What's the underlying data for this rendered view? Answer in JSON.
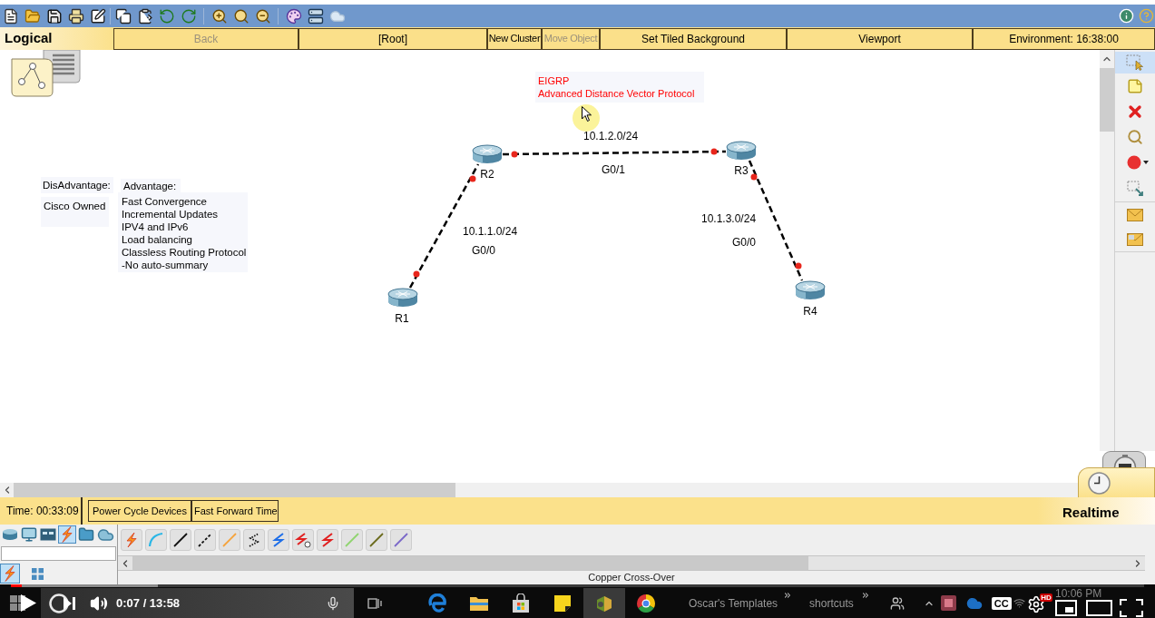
{
  "nav_bar": {
    "mode": "Logical",
    "buttons": [
      {
        "label": "Back",
        "disabled": true
      },
      {
        "label": "[Root]",
        "disabled": false
      },
      {
        "label": "New Cluster",
        "disabled": false
      },
      {
        "label": "Move Object",
        "disabled": true
      },
      {
        "label": "Set Tiled Background",
        "disabled": false
      },
      {
        "label": "Viewport",
        "disabled": false
      },
      {
        "label": "Environment: 16:38:00",
        "disabled": false
      }
    ]
  },
  "canvas": {
    "notes": [
      {
        "lines": [
          "EIGRP",
          "Advanced Distance Vector Protocol"
        ],
        "color": "#ff0000"
      },
      {
        "lines": [
          "DisAdvantage:"
        ],
        "color": "#000000"
      },
      {
        "lines": [
          "Cisco Owned"
        ],
        "color": "#000000"
      },
      {
        "lines": [
          "Advantage:"
        ],
        "color": "#000000"
      },
      {
        "lines": [
          "Fast Convergence",
          "Incremental Updates",
          "IPV4 and IPv6",
          "Load balancing",
          "Classless Routing Protocol",
          "-No auto-summary"
        ],
        "color": "#000000"
      }
    ],
    "devices": [
      {
        "name": "R2"
      },
      {
        "name": "R3"
      },
      {
        "name": "R1"
      },
      {
        "name": "R4"
      }
    ],
    "links": [
      {
        "network": "10.1.2.0/24",
        "interface": "G0/1"
      },
      {
        "network": "10.1.1.0/24",
        "interface": "G0/0"
      },
      {
        "network": "10.1.3.0/24",
        "interface": "G0/0"
      }
    ]
  },
  "tool_palette": {
    "tools": [
      {
        "kind": "select",
        "selected": true
      },
      {
        "kind": "note",
        "selected": false
      },
      {
        "kind": "delete",
        "selected": false
      },
      {
        "kind": "inspect",
        "selected": false
      },
      {
        "kind": "ellipse",
        "selected": false
      },
      {
        "kind": "resize",
        "selected": false
      },
      {
        "kind": "simple_pdu",
        "selected": false
      },
      {
        "kind": "complex_pdu",
        "selected": false
      }
    ]
  },
  "mode_tabs": [
    {
      "kind": "simulation",
      "selected": false
    },
    {
      "kind": "realtime",
      "selected": true
    }
  ],
  "sim_bar": {
    "time": "Time: 00:33:09",
    "buttons": [
      "Power Cycle Devices",
      "Fast Forward Time"
    ],
    "mode": "Realtime"
  },
  "device_palette": {
    "categories": [
      {
        "kind": "router",
        "selected": false
      },
      {
        "kind": "computer",
        "selected": false
      },
      {
        "kind": "panel",
        "selected": false
      },
      {
        "kind": "connections",
        "selected": true
      },
      {
        "kind": "folder",
        "selected": false
      },
      {
        "kind": "cloud",
        "selected": false
      }
    ],
    "subcategories": [
      {
        "kind": "connections",
        "selected": true
      },
      {
        "kind": "grid",
        "selected": false
      }
    ],
    "status": "Copper Cross-Over"
  },
  "video_player": {
    "progress": {
      "level": 0.01
    },
    "buffer": {
      "level": 0.13
    },
    "time": "0:07 / 13:58",
    "captions": "CC",
    "quality": "HD"
  },
  "taskbar": {
    "apps": [
      {
        "kind": "edge",
        "selected": false
      },
      {
        "kind": "explorer",
        "selected": false
      },
      {
        "kind": "store",
        "selected": false
      },
      {
        "kind": "sticky_notes",
        "selected": false
      },
      {
        "kind": "packet_tracer",
        "selected": true
      },
      {
        "kind": "chrome",
        "selected": false
      }
    ],
    "toolbars": [
      "Oscar's Templates",
      "shortcuts"
    ],
    "clock": "10:06 PM"
  }
}
